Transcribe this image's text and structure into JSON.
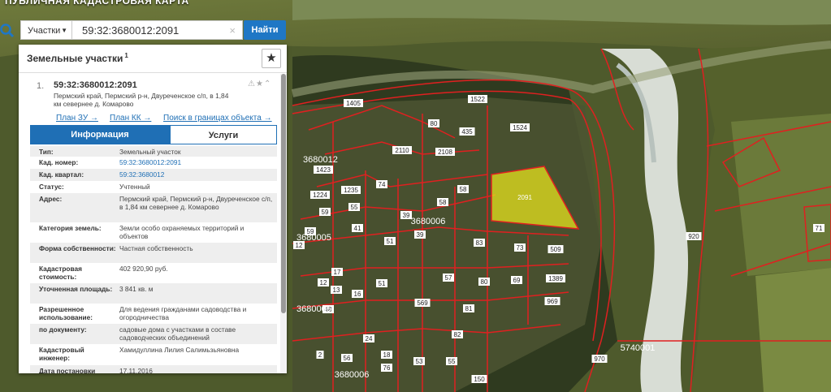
{
  "app": {
    "title": "ПУБЛИЧНАЯ КАДАСТРОВАЯ КАРТА"
  },
  "search": {
    "filter_label": "Участки",
    "query": "59:32:3680012:2091",
    "button_label": "Найти"
  },
  "panel": {
    "title": "Земельные участки",
    "title_sup": "1"
  },
  "result": {
    "index": "1.",
    "cadastral_id": "59:32:3680012:2091",
    "address": "Пермский край, Пермский р-н, Двуреченское с/п, в 1,84 км севернее д. Комарово",
    "links": [
      "План ЗУ →",
      "План КК →",
      "Поиск в границах объекта →"
    ]
  },
  "tabs": {
    "info": "Информация",
    "services": "Услуги"
  },
  "attributes": [
    {
      "label": "Тип:",
      "value": "Земельный участок"
    },
    {
      "label": "Кад. номер:",
      "value": "59:32:3680012:2091"
    },
    {
      "label": "Кад. квартал:",
      "value": "59:32:3680012"
    },
    {
      "label": "Статус:",
      "value": "Учтенный"
    },
    {
      "label": "Адрес:",
      "value": "Пермский край, Пермский р-н, Двуреченское с/п, в 1,84 км севернее д. Комарово"
    },
    {
      "label": "Категория земель:",
      "value": "Земли особо охраняемых территорий и объектов"
    },
    {
      "label": "Форма собственности:",
      "value": "Частная собственность"
    },
    {
      "label": "Кадастровая стоимость:",
      "value": "402 920,90 руб."
    },
    {
      "label": "Уточненная площадь:",
      "value": "3 841 кв. м"
    },
    {
      "label": "Разрешенное использование:",
      "value": "Для ведения гражданами садоводства и огородничества"
    },
    {
      "label": "по документу:",
      "value": "садовые дома с участками в составе садоводческих объединений"
    },
    {
      "label": "Кадастровый инженер:",
      "value": "Хамидуллина Лилия Салимьзьяновна"
    },
    {
      "label": "Дата постановки",
      "value": "17.11.2016"
    }
  ],
  "map": {
    "parcel_labels": [
      "1405",
      "1522",
      "1524",
      "80",
      "435",
      "2110",
      "2108",
      "1423",
      "1224",
      "1235",
      "74",
      "58",
      "59",
      "55",
      "58",
      "39",
      "41",
      "3680006",
      "39",
      "51",
      "83",
      "73",
      "509",
      "12",
      "17",
      "51",
      "57",
      "80",
      "69",
      "1389",
      "16",
      "48",
      "569",
      "969",
      "81",
      "24",
      "82",
      "56",
      "76",
      "53",
      "55",
      "150",
      "970",
      "5740001",
      "920",
      "3680006",
      "2091",
      "12",
      "13",
      "2",
      "18",
      "59",
      "71"
    ],
    "quarter_labels": [
      "3680012",
      "3680005",
      "3680005"
    ],
    "selected_label": "2091",
    "colors": {
      "boundary": "#e02020",
      "selected_fill": "#e6e21e",
      "label_bg": "#ffffff"
    }
  }
}
